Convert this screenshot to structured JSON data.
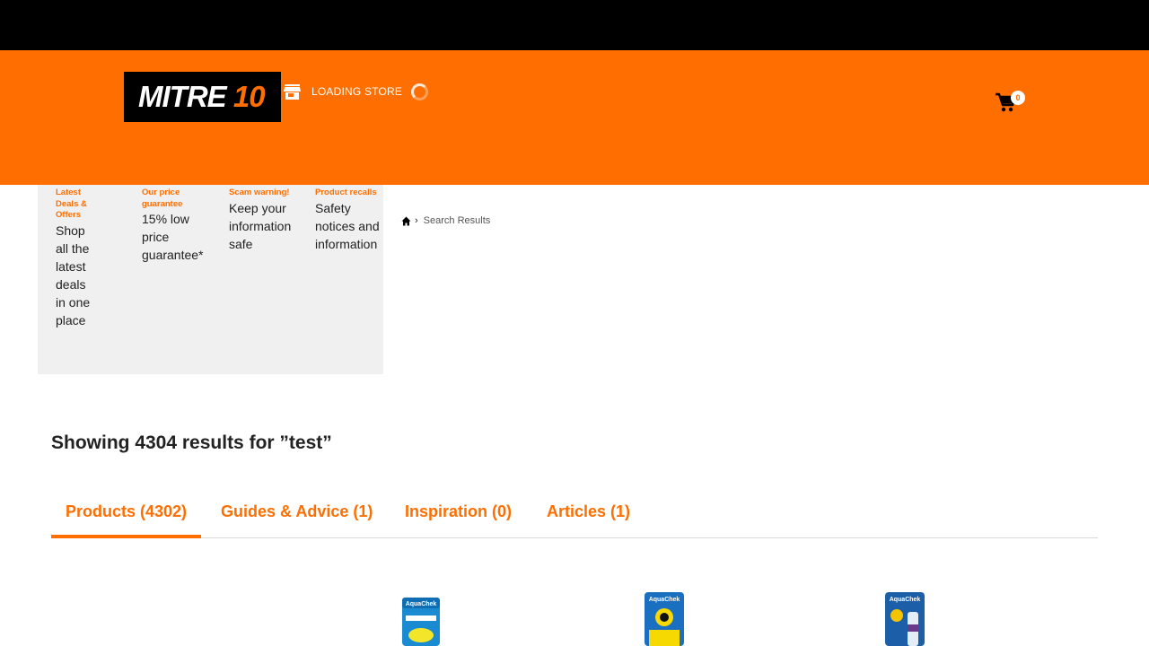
{
  "header": {
    "logo_text": "MITRE",
    "logo_number": "10",
    "store_label": "LOADING STORE",
    "cart_count": "0",
    "brand_color": "#ff6e00"
  },
  "promo": [
    {
      "title": "Latest Deals & Offers",
      "desc": "Shop all the latest deals in one place"
    },
    {
      "title": "Our price guarantee",
      "desc": "15% low price guarantee*"
    },
    {
      "title": "Scam warning!",
      "desc": "Keep your information safe"
    },
    {
      "title": "Product recalls",
      "desc": "Safety notices and information"
    }
  ],
  "breadcrumb": {
    "home_icon": "home-icon",
    "current": "Search Results"
  },
  "results": {
    "heading": "Showing 4304 results for ”test”"
  },
  "tabs": [
    {
      "label": "Products (4302)",
      "active": true
    },
    {
      "label": "Guides & Advice (1)",
      "active": false
    },
    {
      "label": "Inspiration (0)",
      "active": false
    },
    {
      "label": "Articles (1)",
      "active": false
    }
  ],
  "products": [
    {
      "image": "aquachek-chlorine-test-strips",
      "brand_text": "AquaChek"
    },
    {
      "image": "aquachek-yellow-test-strips",
      "brand_text": "AquaChek"
    },
    {
      "image": "aquachek-test-strips-bottle",
      "brand_text": "AquaChek"
    }
  ]
}
